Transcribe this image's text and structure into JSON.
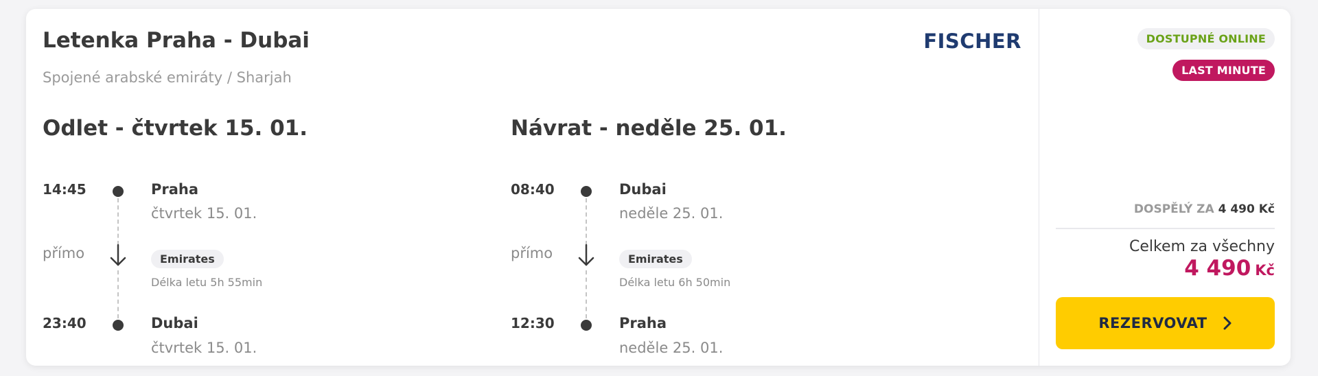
{
  "header": {
    "title": "Letenka Praha - Dubai",
    "subtitle": "Spojené arabské emiráty / Sharjah",
    "brand": "FISCHER"
  },
  "outbound": {
    "heading": "Odlet - čtvrtek 15. 01.",
    "depart_time": "14:45",
    "depart_place": "Praha",
    "depart_date": "čtvrtek 15. 01.",
    "stops": "přímo",
    "airline": "Emirates",
    "duration": "Délka letu 5h 55min",
    "arrive_time": "23:40",
    "arrive_place": "Dubai",
    "arrive_date": "čtvrtek 15. 01."
  },
  "return": {
    "heading": "Návrat - neděle 25. 01.",
    "depart_time": "08:40",
    "depart_place": "Dubai",
    "depart_date": "neděle 25. 01.",
    "stops": "přímo",
    "airline": "Emirates",
    "duration": "Délka letu 6h 50min",
    "arrive_time": "12:30",
    "arrive_place": "Praha",
    "arrive_date": "neděle 25. 01."
  },
  "badges": {
    "online": "DOSTUPNÉ ONLINE",
    "last_minute": "LAST MINUTE"
  },
  "pricing": {
    "adult_label": "DOSPĚLÝ ZA",
    "adult_price": "4 490 Kč",
    "total_label": "Celkem za všechny",
    "total_amount": "4 490",
    "currency": "Kč"
  },
  "cta": {
    "label": "REZERVOVAT",
    "icon": "chevron-right-icon"
  },
  "colors": {
    "accent": "#c0185f",
    "button": "#ffcc00",
    "online": "#6aa218",
    "brand": "#1f3b70"
  }
}
